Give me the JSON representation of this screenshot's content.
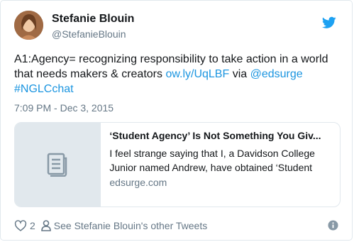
{
  "user": {
    "name": "Stefanie Blouin",
    "handle": "@StefanieBlouin"
  },
  "tweet": {
    "text_parts": {
      "lead": "A1:Agency= recognizing responsibility to take action in a world that needs makers & creators ",
      "link": "ow.ly/UqLBF",
      "mid": " via ",
      "mention": "@edsurge",
      "hashtag": "#NGLCchat"
    },
    "timestamp": "7:09 PM - Dec 3, 2015"
  },
  "card": {
    "title": "‘Student Agency’ Is Not Something You Giv...",
    "description": "I feel strange saying that I, a Davidson College Junior named Andrew, have obtained ‘Student Agency.’ Does that make me a ‘Student Agent,’ a",
    "domain": "edsurge.com"
  },
  "actions": {
    "like_count": "2",
    "see_tweets": "See Stefanie Blouin's other Tweets"
  },
  "colors": {
    "link": "#1b95e0",
    "secondary_text": "#657786",
    "border": "#e1e8ed"
  },
  "icons": [
    "twitter-bird-icon",
    "article-icon",
    "heart-icon",
    "person-icon",
    "info-icon"
  ]
}
